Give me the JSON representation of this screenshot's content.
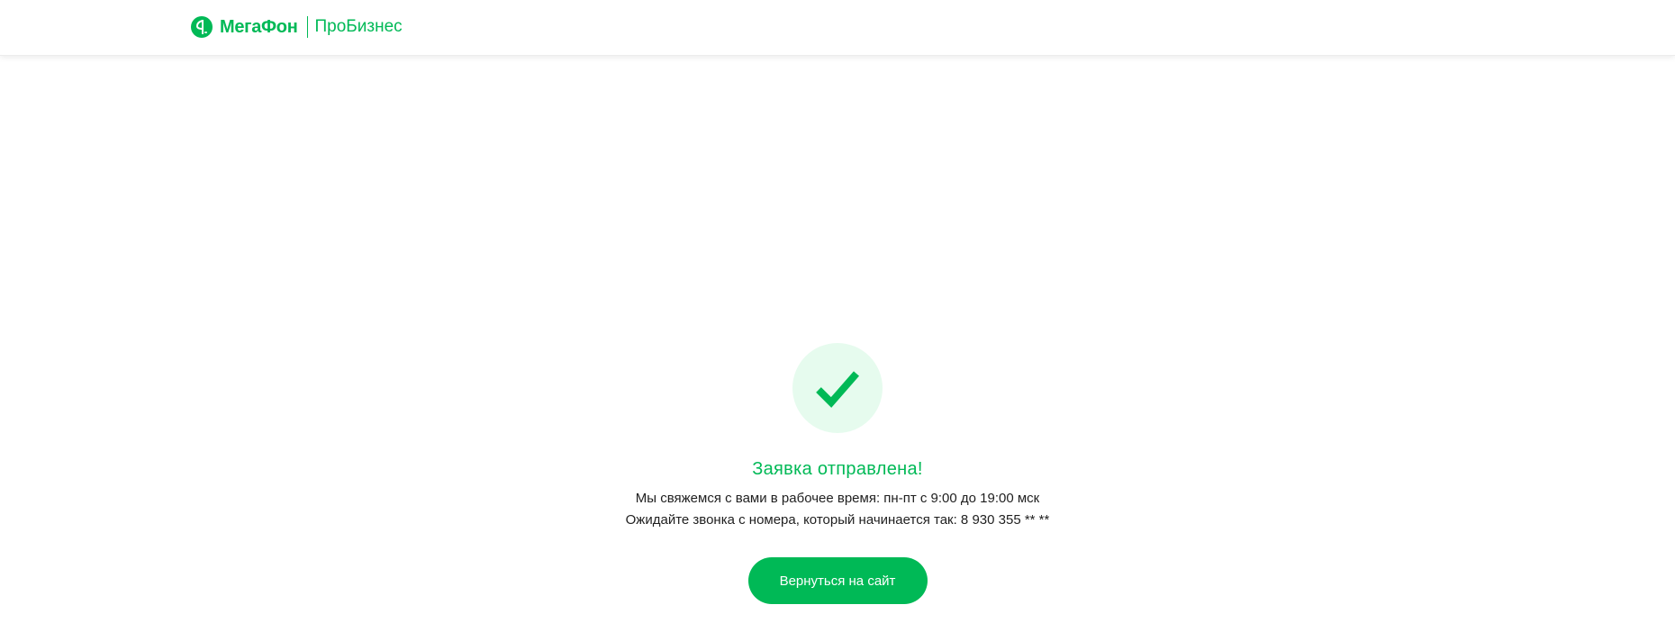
{
  "header": {
    "brand_name": "МегаФон",
    "product_name": "ПроБизнес"
  },
  "confirmation": {
    "title": "Заявка отправлена!",
    "line1": "Мы свяжемся с вами в рабочее время: пн-пт с 9:00 до 19:00 мск",
    "line2": "Ожидайте звонка с номера, который начинается так: 8 930 355 ** **",
    "button_label": "Вернуться на сайт"
  },
  "colors": {
    "brand_green": "#00b956",
    "check_circle_bg": "#e6fbee"
  },
  "icons": {
    "logo": "megafon-logo-icon",
    "status": "checkmark-icon"
  }
}
